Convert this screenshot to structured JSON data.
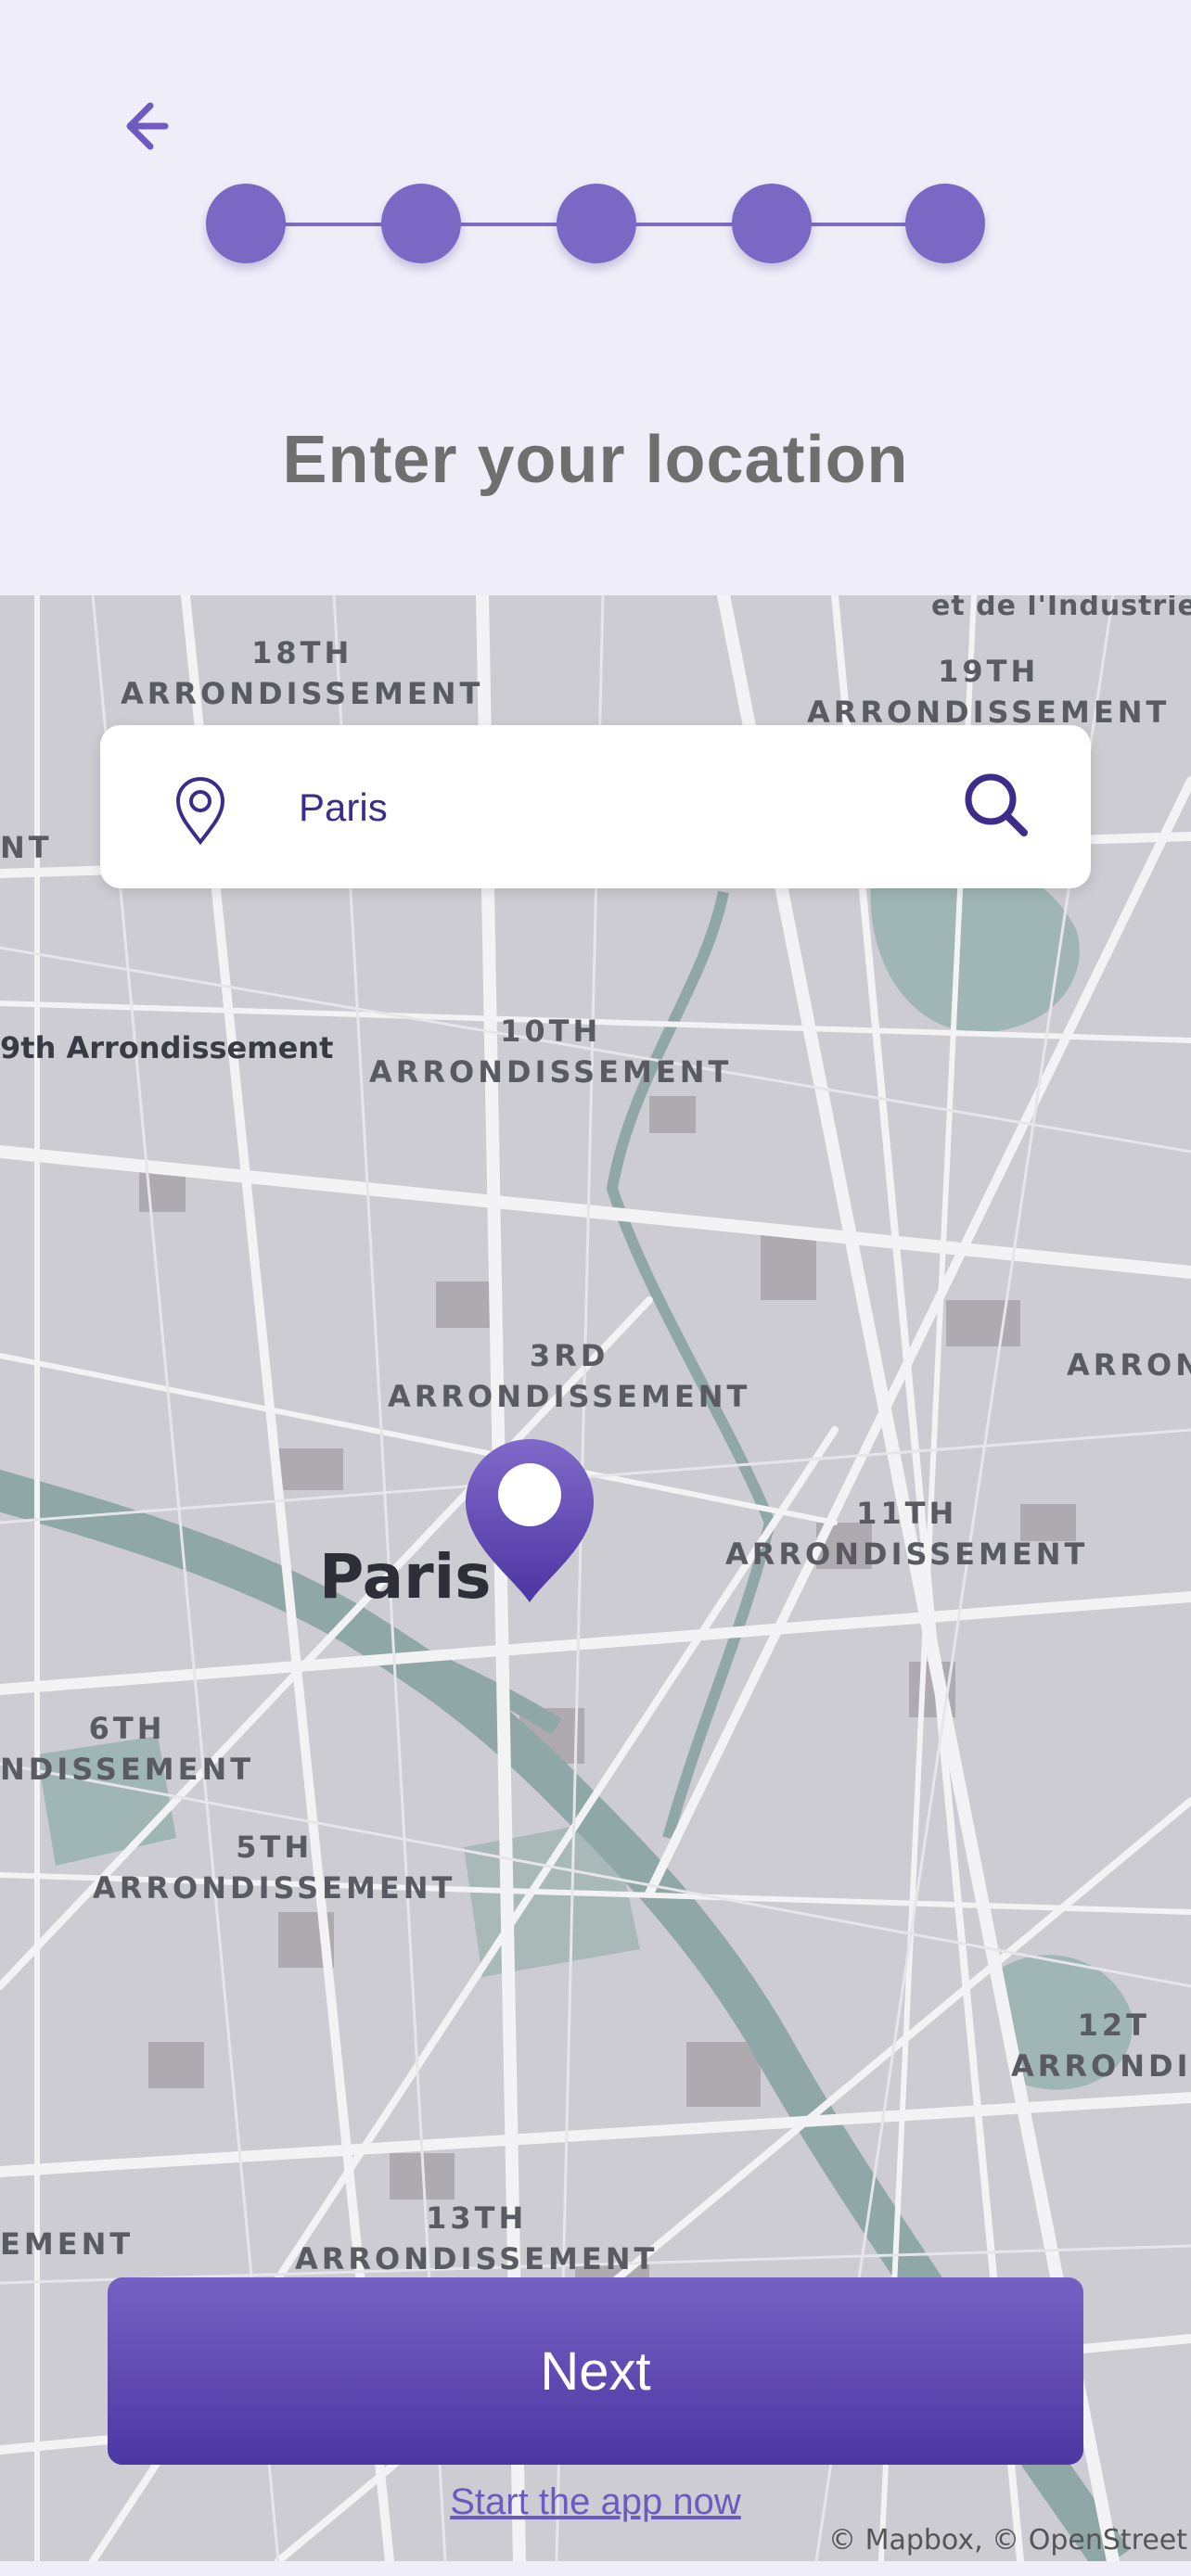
{
  "header": {
    "back_icon": "arrow-left-icon",
    "steps": [
      1,
      2,
      3,
      4,
      5
    ],
    "title": "Enter your location"
  },
  "search": {
    "value": "Paris",
    "pin_icon": "map-pin-icon",
    "search_icon": "search-icon"
  },
  "map": {
    "labels": [
      "18TH\nARRONDISSEMENT",
      "et de l'Industrie",
      "19TH\nARRONDISSEMENT",
      "NT",
      "9th Arrondissement",
      "10TH\nARRONDISSEMENT",
      "3RD\nARRONDISSEMENT",
      "ARRON",
      "11TH\nARRONDISSEMENT",
      "6TH\nNDISSEMENT",
      "5TH\nARRONDISSEMENT",
      "12T\nARRONDIS",
      "EMENT",
      "13TH\nARRONDISSEMENT"
    ],
    "city_label": "Paris",
    "marker_icon": "location-marker-icon",
    "attribution": "© Mapbox, © OpenStreet"
  },
  "actions": {
    "next_label": "Next",
    "start_link": "Start the app now"
  },
  "colors": {
    "accent": "#7b67c4",
    "button_top": "#7561c3",
    "button_bottom": "#4c36a2",
    "background": "#efeef8",
    "title": "#6f6f6f"
  }
}
